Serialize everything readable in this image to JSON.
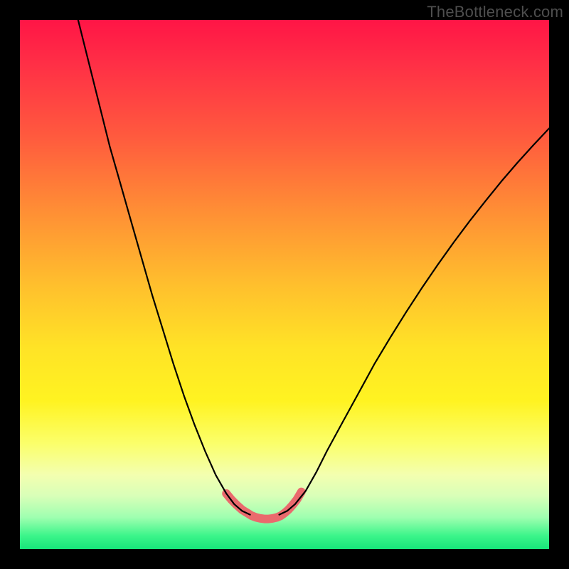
{
  "watermark": "TheBottleneck.com",
  "chart_data": {
    "type": "line",
    "title": "",
    "xlabel": "",
    "ylabel": "",
    "xlim": [
      0,
      100
    ],
    "ylim": [
      0,
      100
    ],
    "series": [
      {
        "name": "left-curve",
        "x": [
          11,
          13,
          15,
          17,
          19,
          21,
          23,
          25,
          27,
          29,
          31,
          33,
          35,
          37,
          39,
          40.5,
          42,
          43.5
        ],
        "y": [
          100,
          92,
          84,
          76,
          69,
          62,
          55,
          48,
          41.5,
          35,
          29,
          23.5,
          18.5,
          14,
          10.5,
          8.5,
          7.2,
          6.5
        ]
      },
      {
        "name": "right-curve",
        "x": [
          49,
          50.5,
          52,
          54,
          56,
          58,
          61,
          64,
          67,
          70,
          73,
          76,
          79,
          82,
          85,
          88,
          91,
          94,
          97,
          100
        ],
        "y": [
          6.5,
          7.2,
          8.5,
          11,
          14.5,
          18.5,
          24,
          29.5,
          35,
          40,
          44.8,
          49.4,
          53.8,
          58,
          62,
          65.8,
          69.5,
          73,
          76.3,
          79.5
        ]
      },
      {
        "name": "valley-highlight",
        "x": [
          39,
          40,
          41,
          42,
          43,
          43.8,
          44.6,
          45.4,
          46.2,
          47,
          47.8,
          48.6,
          49.3,
          50,
          50.7,
          51.5,
          52.3,
          53.2
        ],
        "y": [
          10.5,
          9.3,
          8.3,
          7.4,
          6.8,
          6.3,
          6.0,
          5.8,
          5.7,
          5.7,
          5.8,
          6.0,
          6.3,
          6.8,
          7.4,
          8.3,
          9.3,
          10.8
        ]
      }
    ],
    "styles": {
      "left-curve": {
        "stroke": "#000000",
        "width": 2.2
      },
      "right-curve": {
        "stroke": "#000000",
        "width": 2.2
      },
      "valley-highlight": {
        "stroke": "#ea6a6d",
        "width": 12
      }
    }
  }
}
